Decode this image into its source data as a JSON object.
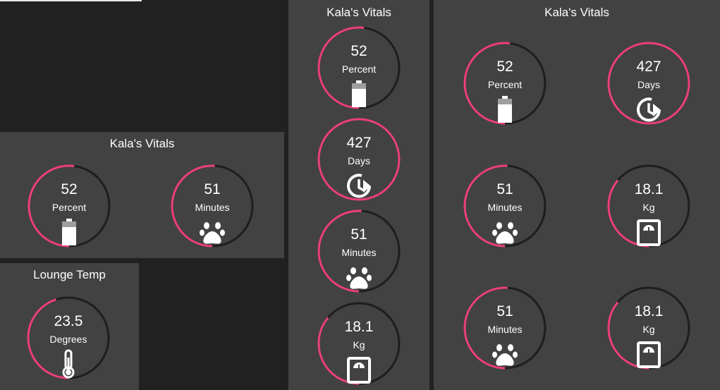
{
  "colors": {
    "accent": "#ec407a",
    "track": "#1e1e1e",
    "card": "#424242",
    "background": "#212121"
  },
  "cards": {
    "vitals_small": {
      "title": "Kala's Vitals",
      "gauges": [
        {
          "value": "52",
          "unit": "Percent",
          "icon": "battery-icon",
          "level": 0.52
        },
        {
          "value": "51",
          "unit": "Minutes",
          "icon": "paw-icon",
          "level": 0.51
        }
      ]
    },
    "lounge": {
      "title": "Lounge Temp",
      "gauges": [
        {
          "value": "23.5",
          "unit": "Degrees",
          "icon": "thermometer-icon",
          "level": 0.45
        }
      ]
    },
    "vitals_column": {
      "title": "Kala's Vitals",
      "gauges": [
        {
          "value": "52",
          "unit": "Percent",
          "icon": "battery-icon",
          "level": 0.52
        },
        {
          "value": "427",
          "unit": "Days",
          "icon": "history-icon",
          "level": 1.0
        },
        {
          "value": "51",
          "unit": "Minutes",
          "icon": "paw-icon",
          "level": 0.51
        },
        {
          "value": "18.1",
          "unit": "Kg",
          "icon": "scale-icon",
          "level": 0.36
        }
      ]
    },
    "vitals_grid": {
      "title": "Kala's Vitals",
      "gauges": [
        {
          "value": "52",
          "unit": "Percent",
          "icon": "battery-icon",
          "level": 0.52
        },
        {
          "value": "427",
          "unit": "Days",
          "icon": "history-icon",
          "level": 1.0
        },
        {
          "value": "51",
          "unit": "Minutes",
          "icon": "paw-icon",
          "level": 0.51
        },
        {
          "value": "18.1",
          "unit": "Kg",
          "icon": "scale-icon",
          "level": 0.36
        },
        {
          "value": "51",
          "unit": "Minutes",
          "icon": "paw-icon",
          "level": 0.51
        },
        {
          "value": "18.1",
          "unit": "Kg",
          "icon": "scale-icon",
          "level": 0.36
        }
      ]
    }
  }
}
